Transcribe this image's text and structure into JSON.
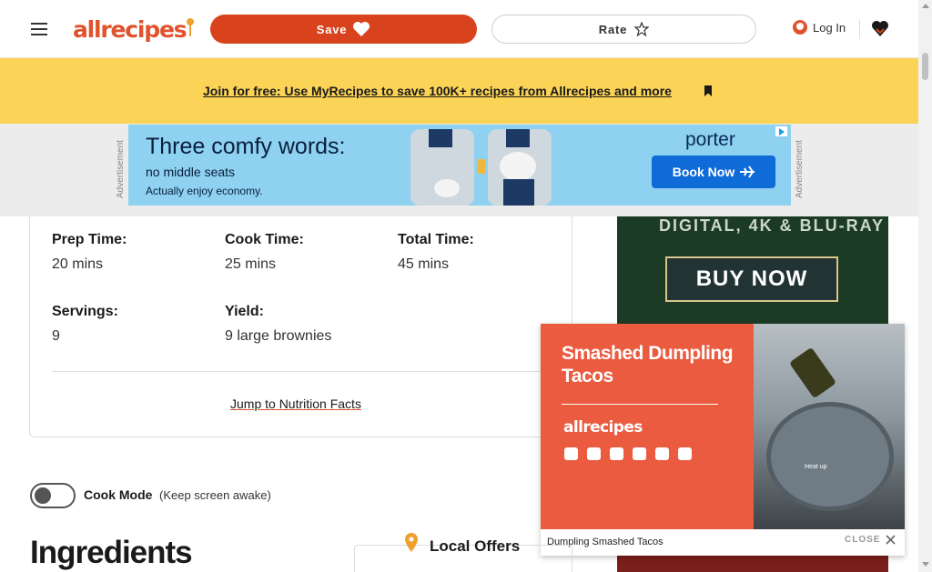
{
  "header": {
    "save_label": "Save",
    "rate_label": "Rate",
    "login_label": "Log In",
    "logo_text": "allrecipes"
  },
  "banner": {
    "link_text": "Join for free: Use MyRecipes to save 100K+ recipes from Allrecipes and more"
  },
  "ad_top": {
    "label": "Advertisement",
    "headline": "Three comfy words:",
    "line1": "no middle seats",
    "line2": "Actually enjoy economy.",
    "brand": "porter",
    "cta": "Book Now"
  },
  "recipe_meta": {
    "prep_label": "Prep Time:",
    "prep_value": "20 mins",
    "cook_label": "Cook Time:",
    "cook_value": "25 mins",
    "total_label": "Total Time:",
    "total_value": "45 mins",
    "servings_label": "Servings:",
    "servings_value": "9",
    "yield_label": "Yield:",
    "yield_value": "9 large brownies",
    "nutrition_link": "Jump to Nutrition Facts"
  },
  "side_ad": {
    "top_text": "DIGITAL, 4K & BLU-RAY",
    "cta": "BUY NOW"
  },
  "video": {
    "title": "Smashed Dumpling Tacos",
    "logo_text": "allrecipes",
    "overlay_text": "Heat up",
    "caption": "Dumpling Smashed Tacos",
    "close_label": "CLOSE"
  },
  "cook_mode": {
    "label": "Cook Mode",
    "sub": "(Keep screen awake)"
  },
  "ingredients_title": "Ingredients",
  "offers_title": "Local Offers",
  "colors": {
    "brand": "#d8421c",
    "banner": "#fbd357"
  }
}
